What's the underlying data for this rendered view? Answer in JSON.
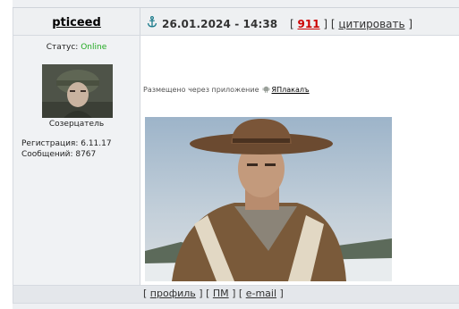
{
  "post": {
    "author": "pticeed",
    "datetime": "26.01.2024 - 14:38",
    "post_number": "911",
    "quote_label": "цитировать"
  },
  "user": {
    "status_label": "Статус:",
    "status_value": "Online",
    "rank": "Созерцатель",
    "registration": "Регистрация: 6.11.17",
    "posts_count": "Сообщений: 8767"
  },
  "body": {
    "posted_via": "Размещено через приложение",
    "app_name": "ЯПлакалъ"
  },
  "footer": {
    "profile": "профиль",
    "pm": "ПМ",
    "email": "e-mail"
  },
  "icons": {
    "anchor": "anchor-icon",
    "android": "android-icon"
  },
  "colors": {
    "online": "#22aa22",
    "post_number": "#cc0000"
  }
}
